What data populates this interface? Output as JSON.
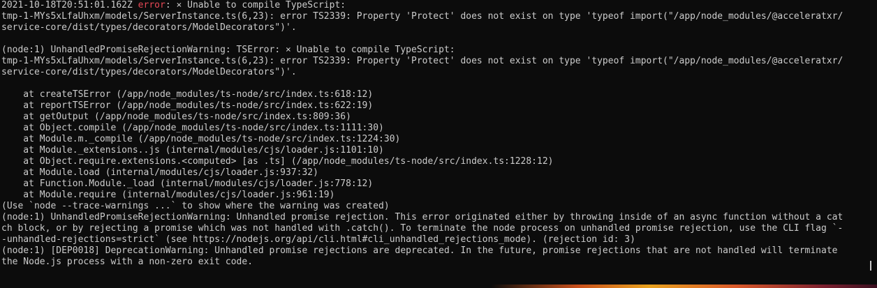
{
  "terminal": {
    "lines": [
      "2021-10-18T20:51:01.162Z ",
      "tmp-1-MYs5xLfaUhxm/models/ServerInstance.ts(6,23): error TS2339: Property 'Protect' does not exist on type 'typeof import(\"/app/node_modules/@acceleratxr/",
      "service-core/dist/types/decorators/ModelDecorators\")'.",
      "",
      "(node:1) UnhandledPromiseRejectionWarning: TSError: ⨯ Unable to compile TypeScript:",
      "tmp-1-MYs5xLfaUhxm/models/ServerInstance.ts(6,23): error TS2339: Property 'Protect' does not exist on type 'typeof import(\"/app/node_modules/@acceleratxr/",
      "service-core/dist/types/decorators/ModelDecorators\")'.",
      "",
      "    at createTSError (/app/node_modules/ts-node/src/index.ts:618:12)",
      "    at reportTSError (/app/node_modules/ts-node/src/index.ts:622:19)",
      "    at getOutput (/app/node_modules/ts-node/src/index.ts:809:36)",
      "    at Object.compile (/app/node_modules/ts-node/src/index.ts:1111:30)",
      "    at Module.m._compile (/app/node_modules/ts-node/src/index.ts:1224:30)",
      "    at Module._extensions..js (internal/modules/cjs/loader.js:1101:10)",
      "    at Object.require.extensions.<computed> [as .ts] (/app/node_modules/ts-node/src/index.ts:1228:12)",
      "    at Module.load (internal/modules/cjs/loader.js:937:32)",
      "    at Function.Module._load (internal/modules/cjs/loader.js:778:12)",
      "    at Module.require (internal/modules/cjs/loader.js:961:19)",
      "(Use `node --trace-warnings ...` to show where the warning was created)",
      "(node:1) UnhandledPromiseRejectionWarning: Unhandled promise rejection. This error originated either by throwing inside of an async function without a cat",
      "ch block, or by rejecting a promise which was not handled with .catch(). To terminate the node process on unhandled promise rejection, use the CLI flag `-",
      "-unhandled-rejections=strict` (see https://nodejs.org/api/cli.html#cli_unhandled_rejections_mode). (rejection id: 3)",
      "(node:1) [DEP0018] DeprecationWarning: Unhandled promise rejections are deprecated. In the future, promise rejections that are not handled will terminate",
      "the Node.js process with a non-zero exit code."
    ],
    "first_line_error_word": "error",
    "first_line_rest": ": ⨯ Unable to compile TypeScript:"
  },
  "colors": {
    "background": "#0c0c0c",
    "foreground": "#cccccc",
    "error": "#e74856"
  }
}
